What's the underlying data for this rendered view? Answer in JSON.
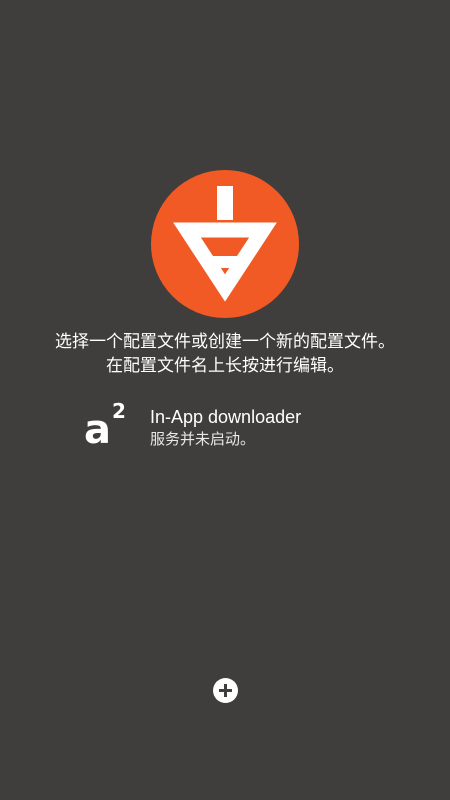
{
  "colors": {
    "background": "#3f3e3c",
    "logo_circle": "#f15a24",
    "logo_glyph": "#ffffff",
    "text": "#ffffff"
  },
  "main": {
    "logo_icon": "app-logo-icon",
    "instructions": {
      "line1": "选择一个配置文件或创建一个新的配置文件。",
      "line2": "在配置文件名上长按进行编辑。"
    }
  },
  "downloader": {
    "icon": "a2-icon",
    "icon_letter": "a",
    "icon_superscript": "2",
    "title": "In-App downloader",
    "status": "服务并未启动。"
  },
  "fab": {
    "icon": "plus-circle-icon"
  }
}
